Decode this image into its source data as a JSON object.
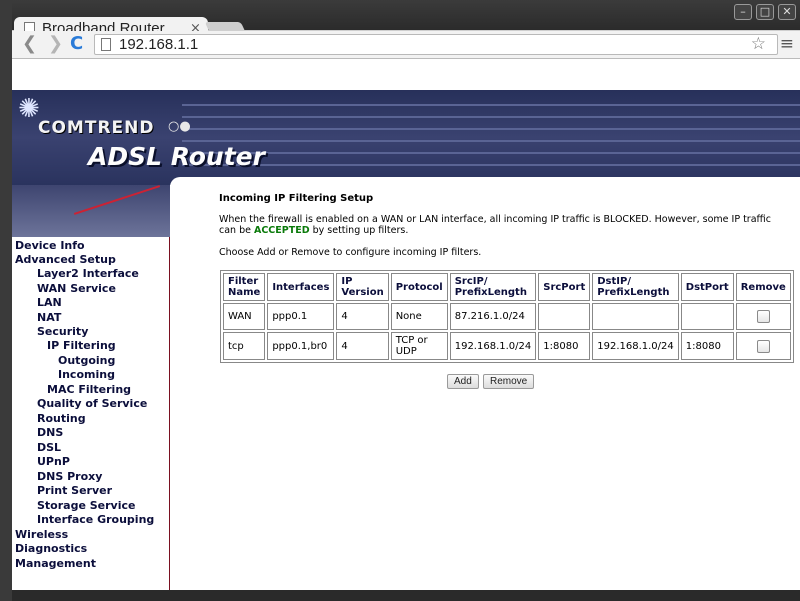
{
  "browser": {
    "tab_title": "Broadband Router",
    "tab_close": "×",
    "url": "192.168.1.1",
    "window_buttons": [
      "–",
      "□",
      "✕"
    ]
  },
  "router": {
    "brand": "COMTREND",
    "product": "ADSL Router"
  },
  "sidebar": {
    "items": [
      {
        "label": "Device Info"
      },
      {
        "label": "Advanced Setup"
      },
      {
        "label": "Layer2 Interface"
      },
      {
        "label": "WAN Service"
      },
      {
        "label": "LAN"
      },
      {
        "label": "NAT"
      },
      {
        "label": "Security"
      },
      {
        "label": "IP Filtering"
      },
      {
        "label": "Outgoing"
      },
      {
        "label": "Incoming"
      },
      {
        "label": "MAC Filtering"
      },
      {
        "label": "Quality of Service"
      },
      {
        "label": "Routing"
      },
      {
        "label": "DNS"
      },
      {
        "label": "DSL"
      },
      {
        "label": "UPnP"
      },
      {
        "label": "DNS Proxy"
      },
      {
        "label": "Print Server"
      },
      {
        "label": "Storage Service"
      },
      {
        "label": "Interface Grouping"
      },
      {
        "label": "Wireless"
      },
      {
        "label": "Diagnostics"
      },
      {
        "label": "Management"
      }
    ]
  },
  "main": {
    "heading": "Incoming IP Filtering Setup",
    "desc_before": "When the firewall is enabled on a WAN or LAN interface, all incoming IP traffic is BLOCKED. However, some IP traffic can be ",
    "desc_bold": "ACCEPTED",
    "desc_after": " by setting up filters.",
    "instruction": "Choose Add or Remove to configure incoming IP filters.",
    "table": {
      "headers": [
        "Filter Name",
        "Interfaces",
        "IP Version",
        "Protocol",
        "SrcIP/ PrefixLength",
        "SrcPort",
        "DstIP/ PrefixLength",
        "DstPort",
        "Remove"
      ],
      "rows": [
        {
          "name": "WAN",
          "interfaces": "ppp0.1",
          "ip_version": "4",
          "protocol": "None",
          "src_ip": "87.216.1.0/24",
          "src_port": "",
          "dst_ip": "",
          "dst_port": "",
          "remove": false
        },
        {
          "name": "tcp",
          "interfaces": "ppp0.1,br0",
          "ip_version": "4",
          "protocol": "TCP or UDP",
          "src_ip": "192.168.1.0/24",
          "src_port": "1:8080",
          "dst_ip": "192.168.1.0/24",
          "dst_port": "1:8080",
          "remove": false
        }
      ]
    },
    "add_label": "Add",
    "remove_label": "Remove"
  }
}
